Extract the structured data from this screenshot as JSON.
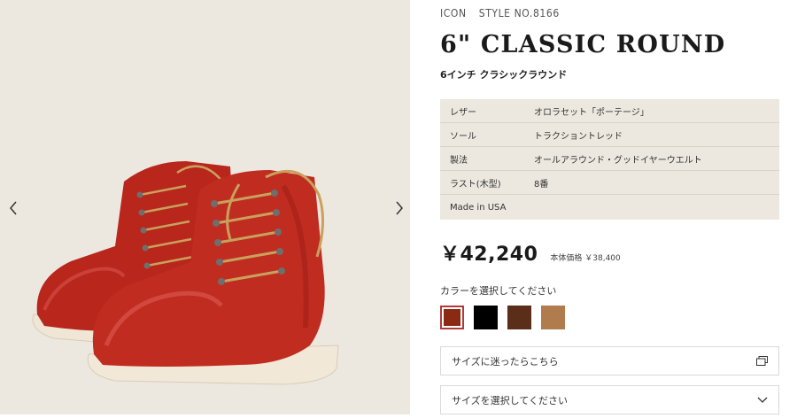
{
  "product": {
    "brand": "ICON",
    "style_no": "STYLE NO.8166",
    "title": "6\" CLASSIC ROUND",
    "subtitle": "6インチ クラシックラウンド"
  },
  "specs": [
    {
      "key": "レザー",
      "value": "オロラセット「ポーテージ」"
    },
    {
      "key": "ソール",
      "value": "トラクショントレッド"
    },
    {
      "key": "製法",
      "value": "オールアラウンド・グッドイヤーウエルト"
    },
    {
      "key": "ラスト(木型)",
      "value": "8番"
    },
    {
      "key": "Made in USA",
      "value": ""
    }
  ],
  "price": {
    "amount": "￥42,240",
    "base_label": "本体価格 ￥38,400"
  },
  "color": {
    "label": "カラーを選択してください",
    "swatches": [
      {
        "hex": "#8a2a12",
        "selected": true
      },
      {
        "hex": "#000000",
        "selected": false
      },
      {
        "hex": "#5a2e18",
        "selected": false
      },
      {
        "hex": "#b07c4e",
        "selected": false
      }
    ]
  },
  "size_guide": {
    "label": "サイズに迷ったらこちら",
    "icon": "external-window-icon"
  },
  "size_select": {
    "label": "サイズを選択してください",
    "icon": "chevron-down-icon"
  },
  "gallery": {
    "prev_icon": "chevron-left-icon",
    "next_icon": "chevron-right-icon",
    "image": "red-leather-boots-pair"
  }
}
